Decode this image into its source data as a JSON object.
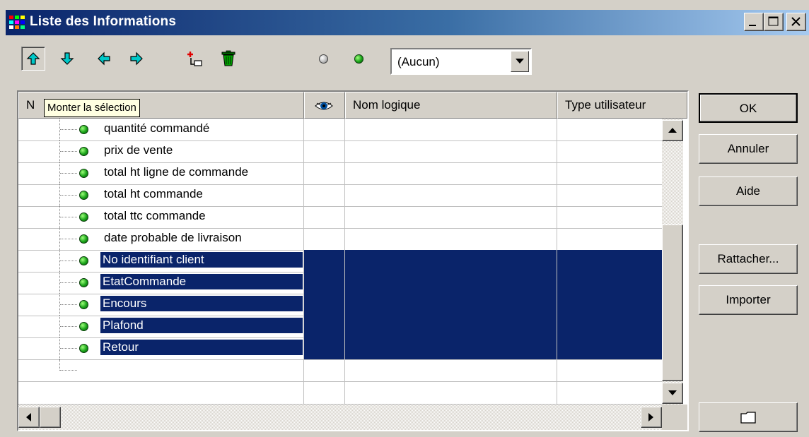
{
  "window": {
    "title": "Liste des Informations"
  },
  "toolbar": {
    "buttons": [
      {
        "name": "move-up",
        "icon": "arrow-up-icon",
        "pressed": true
      },
      {
        "name": "move-down",
        "icon": "arrow-down-icon"
      },
      {
        "name": "move-left",
        "icon": "arrow-left-icon"
      },
      {
        "name": "move-right",
        "icon": "arrow-right-icon"
      },
      {
        "name": "add-item",
        "icon": "add-item-icon"
      },
      {
        "name": "delete",
        "icon": "trash-icon"
      },
      {
        "name": "grey-dot",
        "icon": "grey-dot-icon"
      },
      {
        "name": "green-dot",
        "icon": "green-dot-icon"
      }
    ],
    "combo_value": "(Aucun)"
  },
  "tooltip": "Monter la sélection",
  "grid": {
    "columns": [
      "N",
      "",
      "Nom logique",
      "Type utilisateur"
    ],
    "rows": [
      {
        "label": "quantité commandé",
        "selected": false
      },
      {
        "label": "prix de vente",
        "selected": false
      },
      {
        "label": "total ht ligne de commande",
        "selected": false
      },
      {
        "label": "total ht commande",
        "selected": false
      },
      {
        "label": "total ttc commande",
        "selected": false
      },
      {
        "label": "date probable de livraison",
        "selected": false
      },
      {
        "label": "No identifiant client",
        "selected": true
      },
      {
        "label": "EtatCommande",
        "selected": true
      },
      {
        "label": "Encours",
        "selected": true
      },
      {
        "label": "Plafond",
        "selected": true
      },
      {
        "label": "Retour",
        "selected": true
      }
    ]
  },
  "buttons": {
    "ok": "OK",
    "cancel": "Annuler",
    "help": "Aide",
    "attach": "Rattacher...",
    "import": "Importer"
  },
  "colors": {
    "selection": "#0a246a",
    "title_start": "#0a246a",
    "title_end": "#a6caf0"
  }
}
